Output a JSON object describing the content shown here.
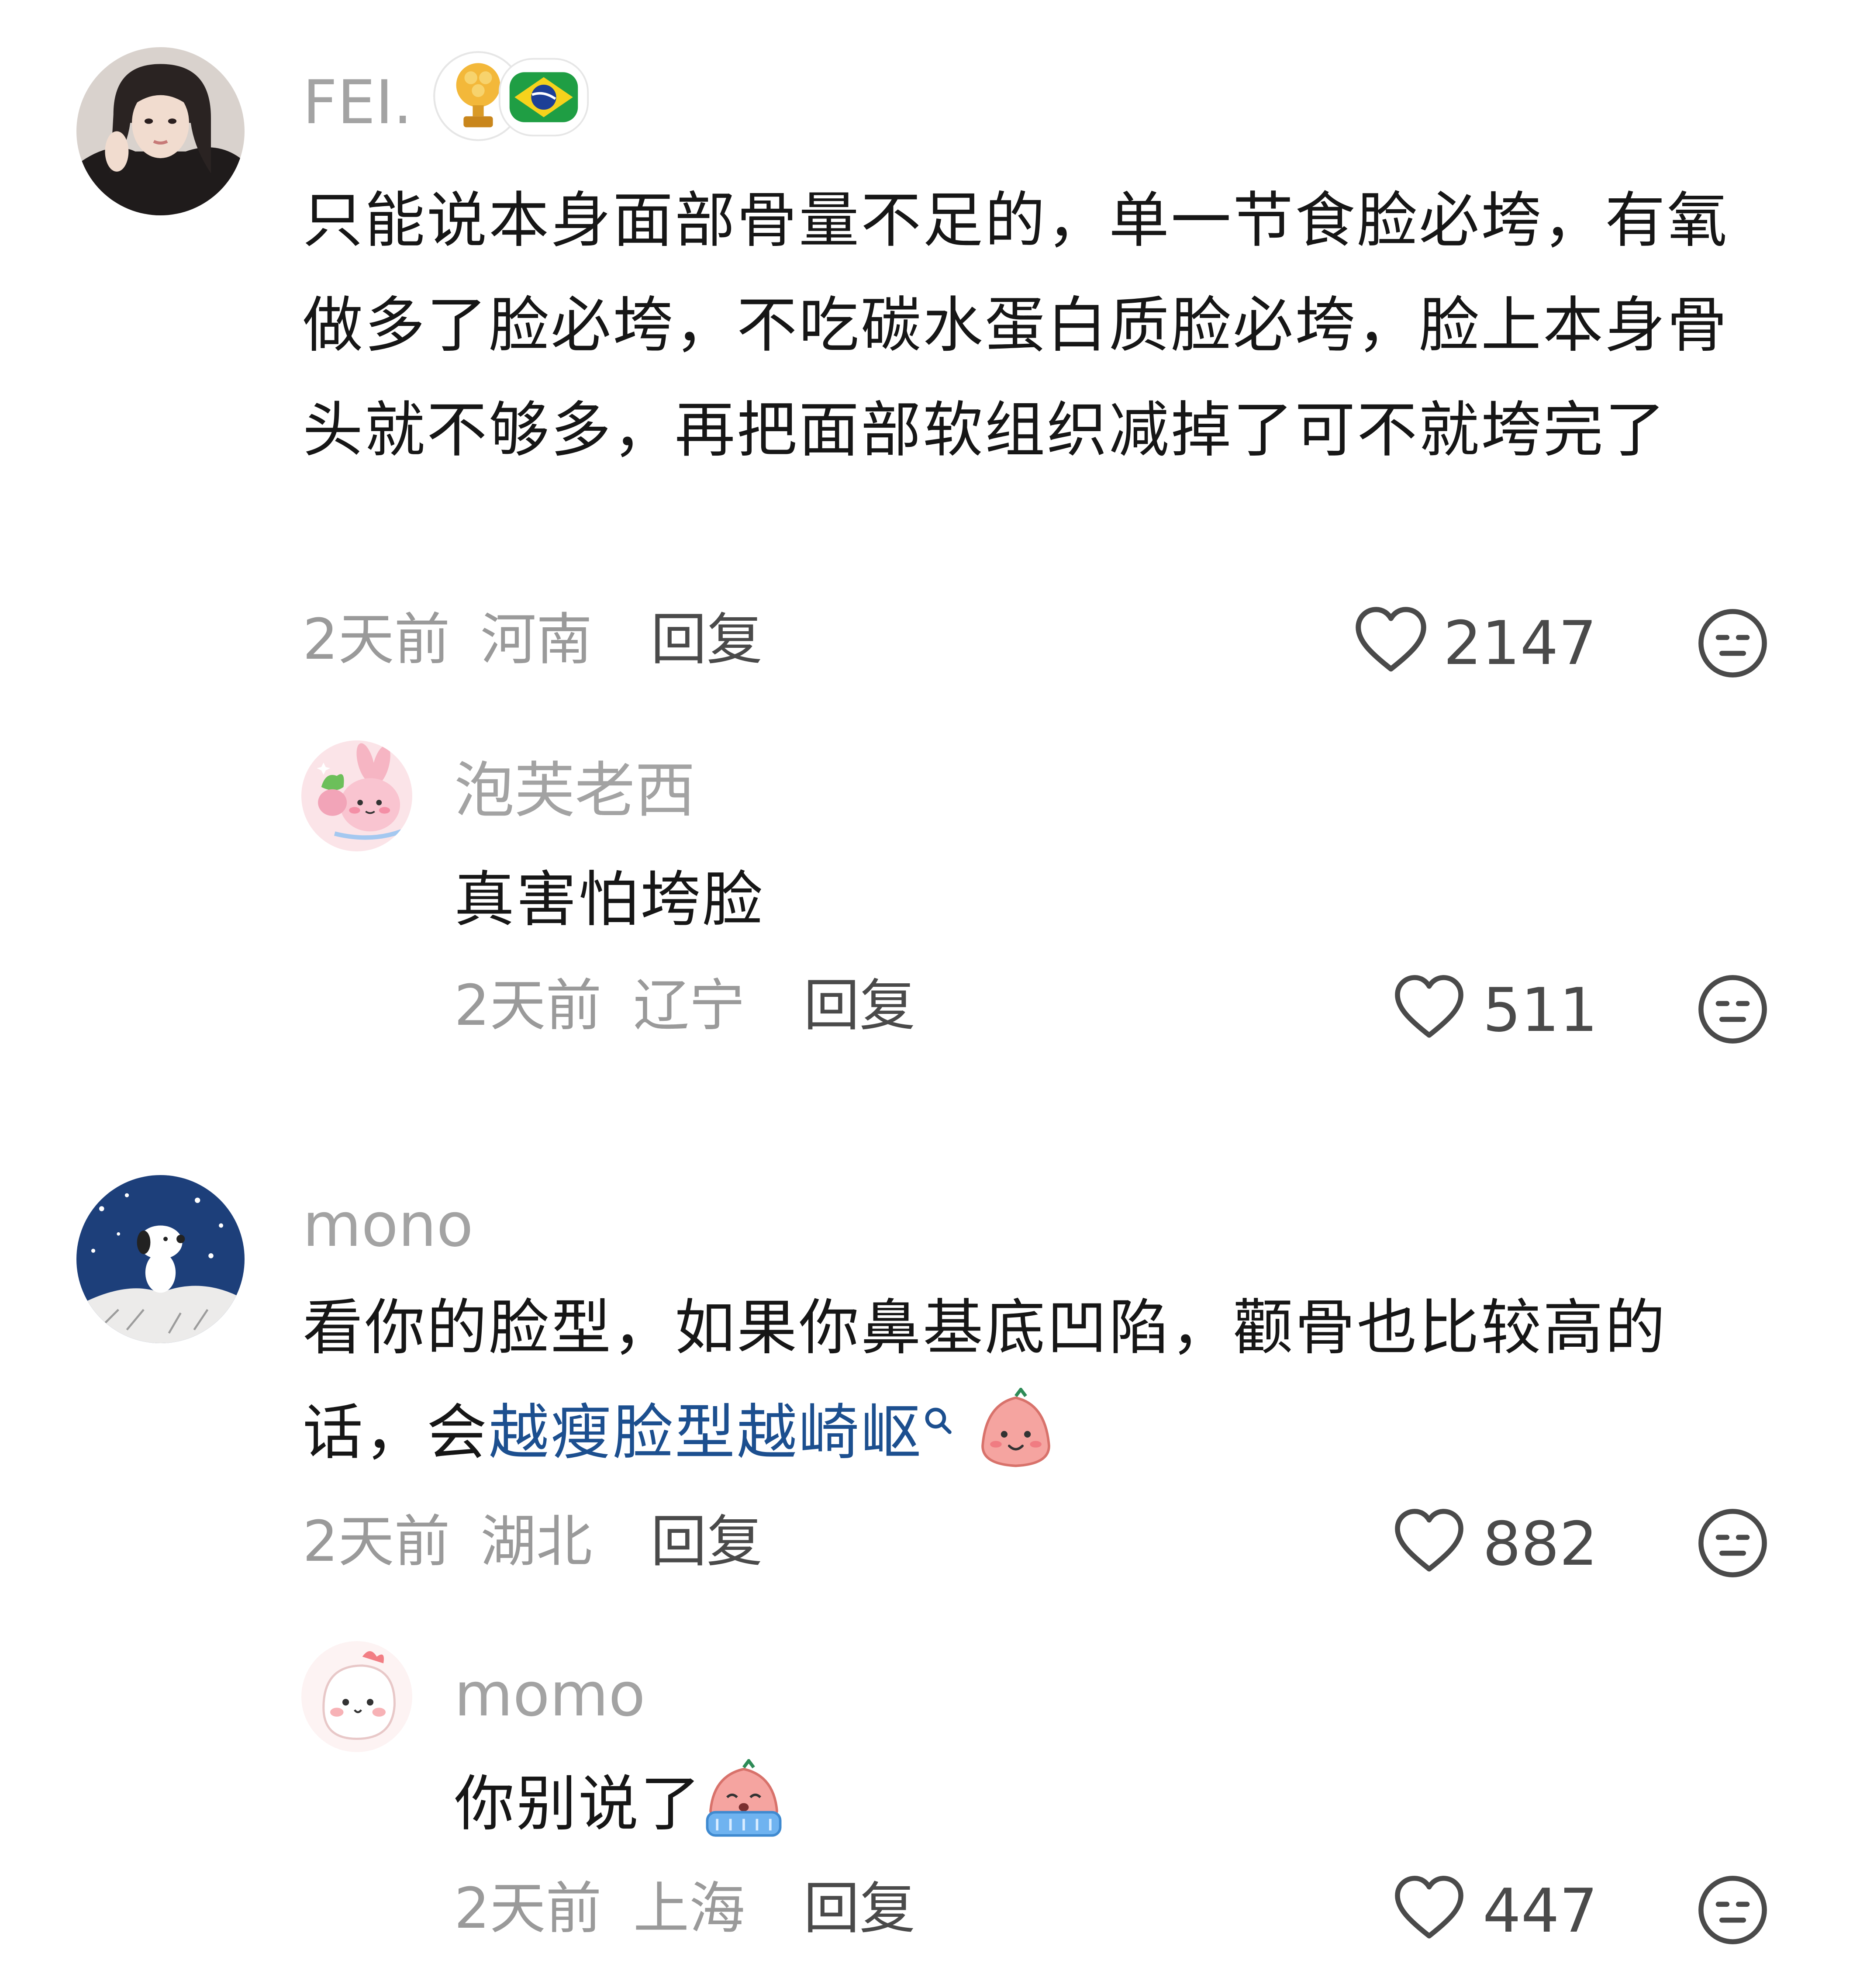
{
  "comments": [
    {
      "username": "FEI.",
      "text": "只能说本身面部骨量不足的，单一节食脸必垮，有氧做多了脸必垮，不吃碳水蛋白质脸必垮，脸上本身骨头就不够多，再把面部软组织减掉了可不就垮完了",
      "time": "2天前",
      "location": "河南",
      "reply_label": "回复",
      "likes": "2147",
      "replies": [
        {
          "username": "泡芙老西",
          "text": "真害怕垮脸",
          "time": "2天前",
          "location": "辽宁",
          "reply_label": "回复",
          "likes": "511"
        }
      ]
    },
    {
      "username": "mono",
      "text_before": "看你的脸型，如果你鼻基底凹陷，颧骨也比较高的话，会",
      "topic_link": "越瘦脸型越崎岖",
      "time": "2天前",
      "location": "湖北",
      "reply_label": "回复",
      "likes": "882",
      "replies": [
        {
          "username": "momo",
          "text": "你别说了",
          "time": "2天前",
          "location": "上海",
          "reply_label": "回复",
          "likes": "447"
        }
      ]
    }
  ],
  "icons": {
    "like": "heart-outline-icon",
    "dislike": "neutral-face-icon",
    "badges": [
      "gold-trophy-badge-icon",
      "brazil-flag-badge-icon"
    ],
    "search": "search-icon"
  },
  "colors": {
    "username": "#a3a3a3",
    "body": "#161616",
    "meta": "#9a9a9a",
    "link": "#1c4f8f",
    "action": "#4a4a4a"
  }
}
